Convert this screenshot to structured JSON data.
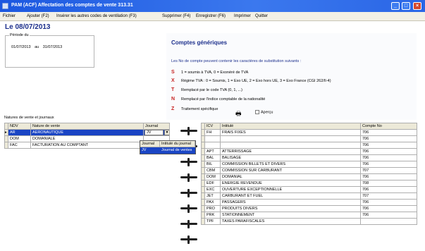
{
  "window": {
    "title": "PAM (ACF) Affectation des comptes de vente 313.31",
    "min_glyph": "_",
    "max_glyph": "□",
    "close_glyph": "×"
  },
  "menu": [
    {
      "label": "Fichier"
    },
    {
      "label": "Ajouter (F2)"
    },
    {
      "label": "Insérer les autres codes de ventilation (F3)"
    },
    {
      "label": "Supprimer (F4)"
    },
    {
      "label": "Enregistrer (F6)"
    },
    {
      "label": "Imprimer"
    },
    {
      "label": "Quitter"
    }
  ],
  "header": {
    "date_label": "Le 08/07/2013",
    "periode_legend": "Période du",
    "date_from": "01/07/2013",
    "date_sep": "au",
    "date_to": "31/07/2013"
  },
  "info": {
    "title": "Comptes génériques",
    "intro": "Les No de compte peuvent contenir les caractères de substitution suivants :",
    "rules": [
      {
        "letter": "S",
        "text": "1 = soumis à TVA,                 0 = Exonéré de TVA"
      },
      {
        "letter": "X",
        "text": "Régime TVA :   0 = Soumis,    1 = Exo UE,     2 = Exo hors UE,    3 = Exo France (CGI 262/II-4)"
      },
      {
        "letter": "T",
        "text": "Remplacé par le code TVA (0, 1, ...)"
      },
      {
        "letter": "N",
        "text": "Remplacé par l'indice comptable de la nationalité"
      },
      {
        "letter": "Z",
        "text": "Traitement spécifique"
      }
    ],
    "apercu_label": "Aperçu"
  },
  "left_table": {
    "title": "Natures de vente et journaux",
    "headers": [
      "NDV",
      "Nature de vente",
      "Journal"
    ],
    "rows": [
      {
        "ndv": "AR",
        "nature": "AERONAUTIQUE",
        "journal": "JV"
      },
      {
        "ndv": "DOM",
        "nature": "DOMANIALE",
        "journal": ""
      },
      {
        "ndv": "FAC",
        "nature": "FACTURATION AU COMPTANT",
        "journal": ""
      }
    ],
    "dropdown_glyph": "▼"
  },
  "dropdown": {
    "headers": [
      "Journal",
      "Intitulé du journal"
    ],
    "rows": [
      {
        "code": "JV",
        "label": "Journal de ventes"
      }
    ]
  },
  "right_table": {
    "headers": [
      "ICV",
      "Intitulé",
      "Compte No"
    ],
    "rows": [
      {
        "icv": "FH",
        "label": "FRAIS FIXES",
        "compte": "706"
      },
      {
        "icv": "",
        "label": "",
        "compte": "706"
      },
      {
        "icv": "",
        "label": "",
        "compte": "706"
      },
      {
        "icv": "APT",
        "label": "ATTERRISSAGE",
        "compte": "706"
      },
      {
        "icv": "BAL",
        "label": "BALISAGE",
        "compte": "706"
      },
      {
        "icv": "BIL",
        "label": "COMMISSION BILLETS ET DIVERS",
        "compte": "706"
      },
      {
        "icv": "CBM",
        "label": "COMMISSION SUR CARBURANT",
        "compte": "707"
      },
      {
        "icv": "DOM",
        "label": "DOMANIAL",
        "compte": "706"
      },
      {
        "icv": "EDF",
        "label": "ENERGIE REVENDUE",
        "compte": "708"
      },
      {
        "icv": "EXC",
        "label": "OUVERTURE EXCEPTIONNELLE",
        "compte": "706"
      },
      {
        "icv": "JET",
        "label": "CARBURANT ET FUEL",
        "compte": "707"
      },
      {
        "icv": "PAX",
        "label": "PASSAGERS",
        "compte": "706"
      },
      {
        "icv": "PRO",
        "label": "PRODUITS DIVERS",
        "compte": "706"
      },
      {
        "icv": "PRK",
        "label": "STATIONNEMENT",
        "compte": "706"
      },
      {
        "icv": "TPF",
        "label": "TAXES PARAFISCALES",
        "compte": ""
      }
    ]
  },
  "colors": {
    "titlebar": "#2a66e6",
    "selection": "#1a45c4",
    "heading": "#1c2f8c",
    "rule_letter": "#c62020"
  }
}
